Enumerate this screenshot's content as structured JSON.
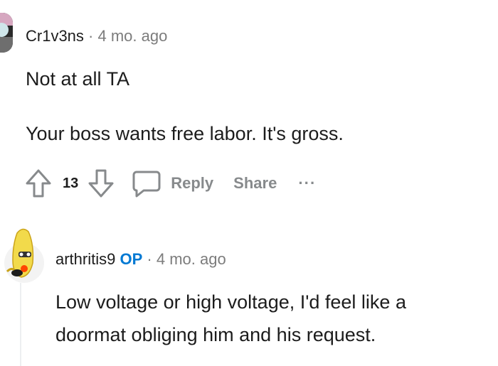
{
  "comment1": {
    "author": "Cr1v3ns",
    "separator": "·",
    "time": "4 mo. ago",
    "line1": "Not at all TA",
    "line2": "Your boss wants free labor. It's gross.",
    "score": "13",
    "reply_label": "Reply",
    "share_label": "Share",
    "more_label": "···"
  },
  "comment2": {
    "author": "arthritis9",
    "op_badge": "OP",
    "separator": "·",
    "time": "4 mo. ago",
    "line1": "Low voltage or high voltage, I'd feel like a",
    "line2": "doormat obliging him and his request."
  },
  "colors": {
    "op_blue": "#0079d3",
    "muted_gray": "#878a8c",
    "meta_gray": "#7c7c7c",
    "thread_line": "#edeff1"
  },
  "icons": [
    "upvote-icon",
    "downvote-icon",
    "comment-bubble-icon",
    "more-icon"
  ]
}
